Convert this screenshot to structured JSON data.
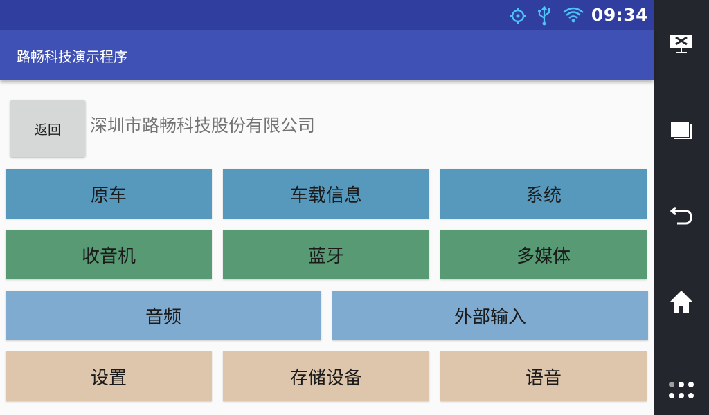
{
  "status_bar": {
    "time": "09:34",
    "icons": [
      "gps-icon",
      "usb-icon",
      "wifi-icon"
    ]
  },
  "app_bar": {
    "title": "路畅科技演示程序"
  },
  "header": {
    "back_label": "返回",
    "company_name": "深圳市路畅科技股份有限公司"
  },
  "menu": {
    "original_car": "原车",
    "vehicle_info": "车载信息",
    "system": "系统",
    "radio": "收音机",
    "bluetooth": "蓝牙",
    "multimedia": "多媒体",
    "audio": "音频",
    "external_input": "外部输入",
    "settings": "设置",
    "storage": "存储设备",
    "voice": "语音"
  },
  "nav_bar": {
    "icons": [
      "screen-mirror-icon",
      "recent-apps-icon",
      "back-icon",
      "home-icon",
      "apps-grid-icon"
    ]
  },
  "colors": {
    "status_bar": "#303f9f",
    "app_bar": "#3f51b5",
    "row_blue": "#5699bd",
    "row_green": "#579a73",
    "row_light_blue": "#7fabd0",
    "row_beige": "#dec6ad",
    "nav_bar": "#23262d",
    "status_icon": "#4fc3f7"
  }
}
